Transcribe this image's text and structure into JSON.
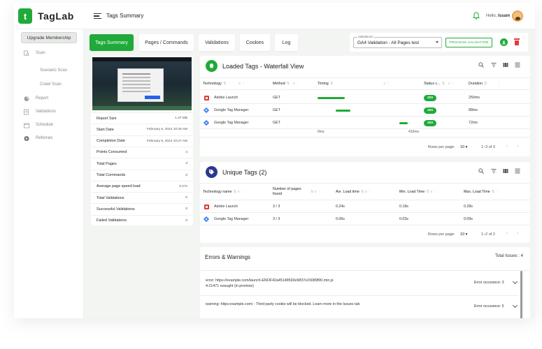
{
  "brand": {
    "name": "TagLab",
    "mark": "t"
  },
  "header": {
    "title": "Tags Summary",
    "greeting": "Hello,",
    "user": "Issam"
  },
  "sidebar": {
    "upgrade_label": "Upgrade Membership",
    "scan": "Scan",
    "scenario_scan": "Scenario Scan",
    "crawl_scan": "Crawl Scan",
    "report": "Report",
    "validations": "Validations",
    "schedule": "Schedule",
    "referrals": "Referrals"
  },
  "tabs": [
    {
      "label": "Tags Summary",
      "active": true
    },
    {
      "label": "Pages / Commands"
    },
    {
      "label": "Validations"
    },
    {
      "label": "Cookies"
    },
    {
      "label": "Log"
    }
  ],
  "validation_select": {
    "label": "Validations",
    "value": "GA4 Validation - All Pages test"
  },
  "process_button": "PROCESS VALIDATION",
  "summary": [
    {
      "label": "Report Size",
      "value": "1.37 MB"
    },
    {
      "label": "Start Date",
      "value": "February 6, 2024 10:26 AM"
    },
    {
      "label": "Completion Date",
      "value": "February 6, 2024 10:27 AM"
    },
    {
      "label": "Points Consumed",
      "value": "4"
    },
    {
      "label": "Total Pages",
      "value": "3"
    },
    {
      "label": "Total Commands",
      "value": "0"
    },
    {
      "label": "Average page speed load",
      "value": "0.27s"
    },
    {
      "label": "Total Validations",
      "value": "0"
    },
    {
      "label": "Successful Validations",
      "value": "0"
    },
    {
      "label": "Failed Validations",
      "value": "0"
    }
  ],
  "loaded_tags": {
    "title": "Loaded Tags - Waterfall View",
    "columns": [
      "Technology",
      "Method",
      "Timing",
      "Status c...",
      "Duration"
    ],
    "rows": [
      {
        "tech": "Adobe Launch",
        "icon": "adobe",
        "method": "GET",
        "status": "200",
        "duration": "250ms",
        "bar_start": 0.0,
        "bar_len": 0.3
      },
      {
        "tech": "Google Tag Manager",
        "icon": "gtm",
        "method": "GET",
        "status": "200",
        "duration": "88ms",
        "bar_start": 0.2,
        "bar_len": 0.16
      },
      {
        "tech": "Google Tag Manager",
        "icon": "gtm",
        "method": "GET",
        "status": "200",
        "duration": "72ms",
        "bar_start": 0.9,
        "bar_len": 0.09
      }
    ],
    "axis_start": "0ms",
    "axis_end": "410ms",
    "rows_per_page_label": "Rows per page:",
    "rows_per_page": "10",
    "range": "1–3 of 3"
  },
  "unique_tags": {
    "title": "Unique Tags (2)",
    "columns": [
      "Technology name",
      "Number of pages found",
      "Avr. Load time",
      "Min. Load Time",
      "Max. Load Time"
    ],
    "rows": [
      {
        "tech": "Adobe Launch",
        "icon": "adobe",
        "pages": "3 / 3",
        "avg": "0.24s",
        "min": "0.18s",
        "max": "0.28s"
      },
      {
        "tech": "Google Tag Manager",
        "icon": "gtm",
        "pages": "3 / 3",
        "avg": "0.06s",
        "min": "0.03s",
        "max": "0.09s"
      }
    ],
    "rows_per_page_label": "Rows per page:",
    "rows_per_page": "10",
    "range": "1–2 of 2"
  },
  "errors": {
    "title": "Errors & Warnings",
    "total": "Total Issues : 4",
    "items": [
      {
        "line1": "error: https://example.com/launch-ENOF42a45148593e9837e15089f00.min.js",
        "line2": "4:21471 nosught (in promise)",
        "occurrence": "Error occurance: 3"
      },
      {
        "line1": "warning: https:example.com/ - Third-party cookie will be blocked. Learn more in the Issues tab",
        "line2": "",
        "occurrence": "Error occurance: 5"
      }
    ]
  }
}
